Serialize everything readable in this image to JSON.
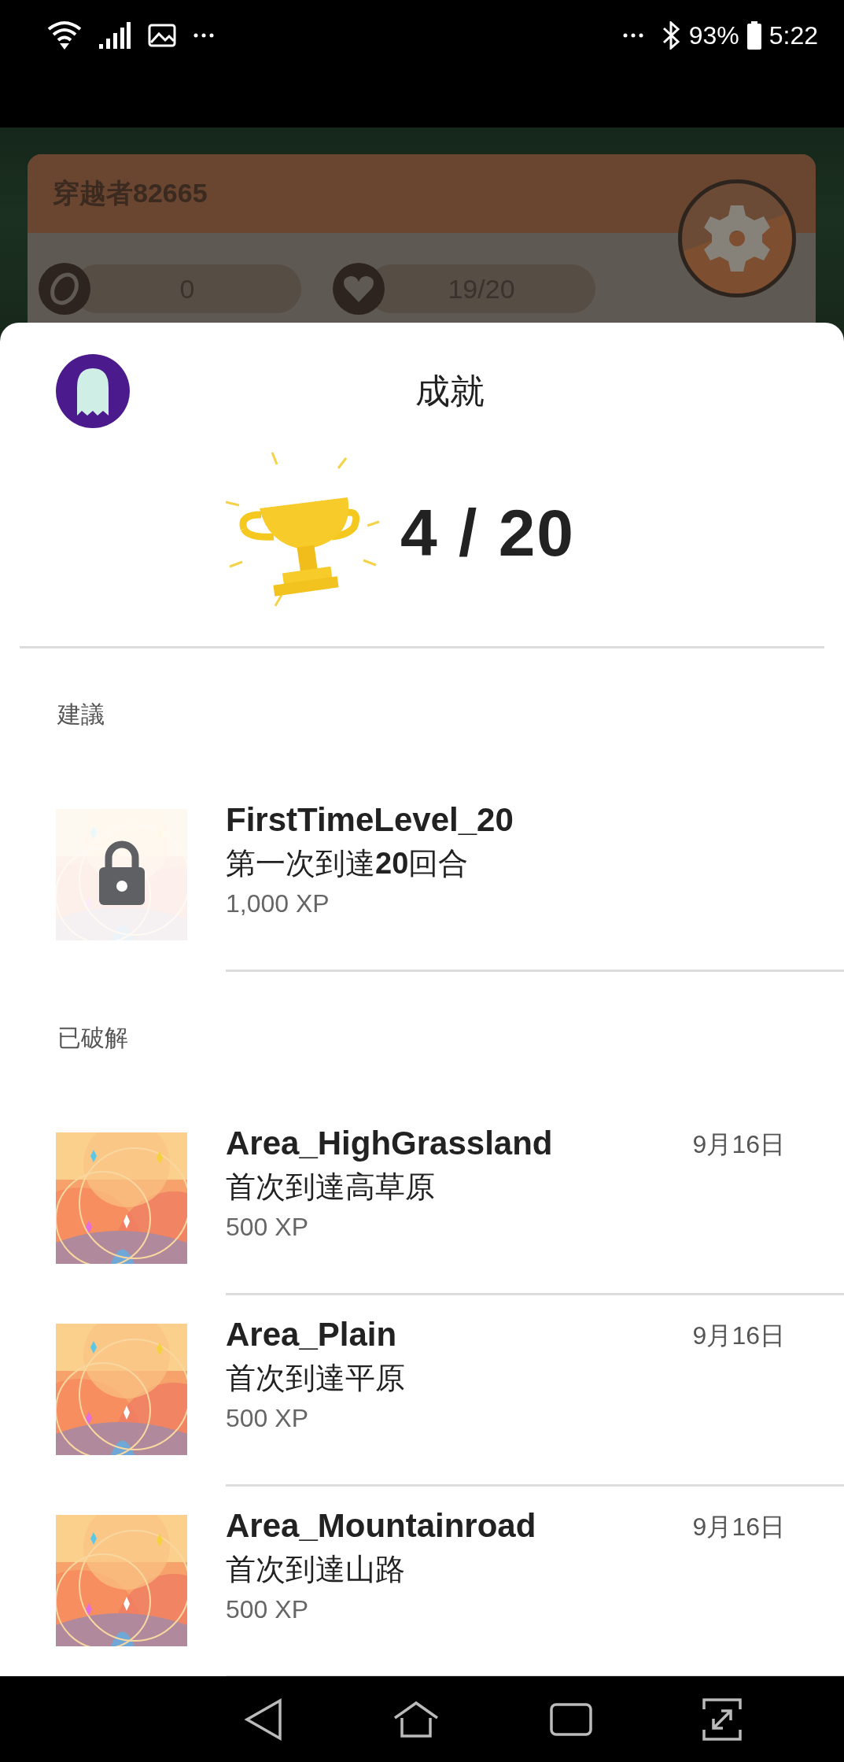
{
  "status_bar": {
    "battery": "93%",
    "time": "5:22"
  },
  "game_header": {
    "player_name": "穿越者82665",
    "coins": "0",
    "lives": "19/20"
  },
  "achievements": {
    "title": "成就",
    "progress": "4 / 20",
    "sections": [
      {
        "label": "建議",
        "items": [
          {
            "name": "FirstTimeLevel_20",
            "description": "第一次到達**20**回合",
            "xp": "1,000 XP",
            "locked": true
          }
        ]
      },
      {
        "label": "已破解",
        "items": [
          {
            "name": "Area_HighGrassland",
            "description": "首次到達高草原",
            "xp": "500 XP",
            "date": "9月16日",
            "locked": false
          },
          {
            "name": "Area_Plain",
            "description": "首次到達平原",
            "xp": "500 XP",
            "date": "9月16日",
            "locked": false
          },
          {
            "name": "Area_Mountainroad",
            "description": "首次到達山路",
            "xp": "500 XP",
            "date": "9月16日",
            "locked": false
          }
        ]
      }
    ]
  }
}
